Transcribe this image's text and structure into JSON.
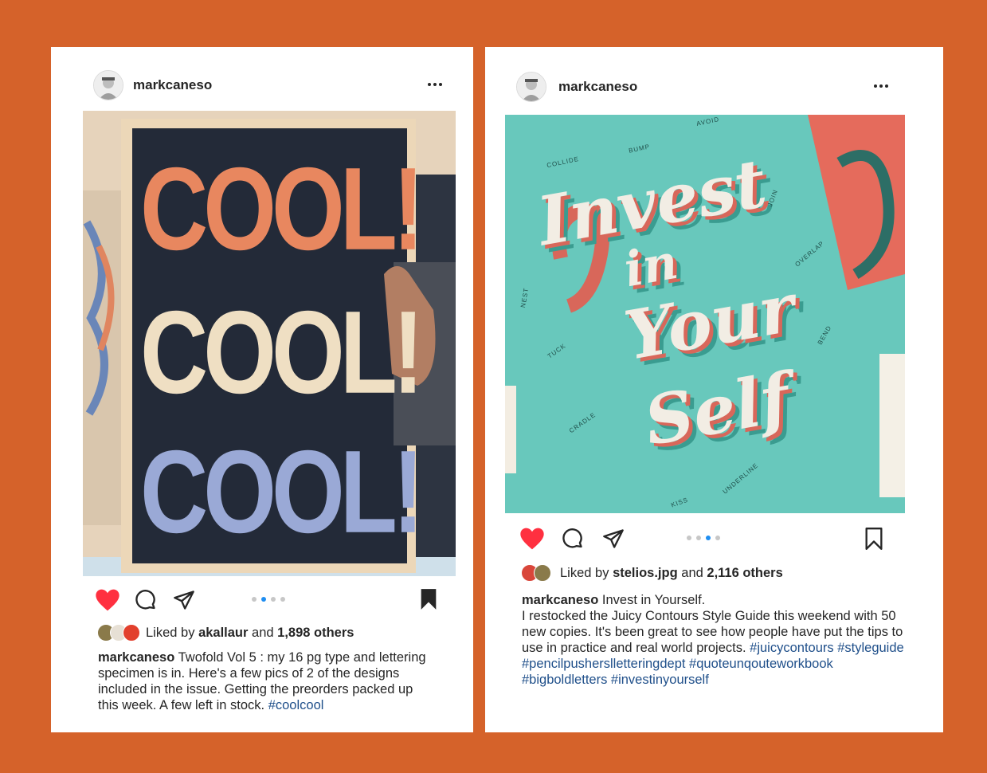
{
  "colors": {
    "background": "#d5622a",
    "like_red": "#ff3040",
    "dot_active": "#1f8ef1",
    "hashtag": "#1f4f8a"
  },
  "post1": {
    "username": "markcaneso",
    "carousel": {
      "count": 4,
      "active_index": 1
    },
    "poster_words": [
      "COOL!",
      "COOL!",
      "COOL!"
    ],
    "liked": true,
    "saved": true,
    "likes": {
      "prefix": "Liked by",
      "user": "akallaur",
      "joiner": "and",
      "others": "1,898 others"
    },
    "caption": {
      "username": "markcaneso",
      "text": "Twofold Vol 5 : my 16 pg type and lettering specimen is in. Here's a few pics of 2 of the designs included in the issue. Getting the preorders packed up this week. A few left in stock.",
      "hashtags": [
        "#coolcool"
      ]
    }
  },
  "post2": {
    "username": "markcaneso",
    "carousel": {
      "count": 4,
      "active_index": 2
    },
    "poster_title": [
      "Invest",
      "in",
      "Your",
      "Self"
    ],
    "poster_labels": [
      "COLLIDE",
      "BUMP",
      "AVOID",
      "JOIN",
      "OVERLAP",
      "NEST",
      "TUCK",
      "BEND",
      "CRADLE",
      "UNDERLINE",
      "KISS"
    ],
    "liked": true,
    "saved": false,
    "likes": {
      "prefix": "Liked by",
      "user": "stelios.jpg",
      "joiner": "and",
      "others": "2,116 others"
    },
    "caption": {
      "username": "markcaneso",
      "title": "Invest in Yourself.",
      "text": "I restocked the Juicy Contours Style Guide this weekend with 50 new copies. It's been great to see how people have put the tips to use in practice and real world projects.",
      "hashtags_line1": "#juicycontours #styleguide",
      "hashtags_line2": "#pencilpusherslletteringdept #quoteunqouteworkbook",
      "hashtags_line3": "#bigboldletters #investinyourself"
    }
  }
}
